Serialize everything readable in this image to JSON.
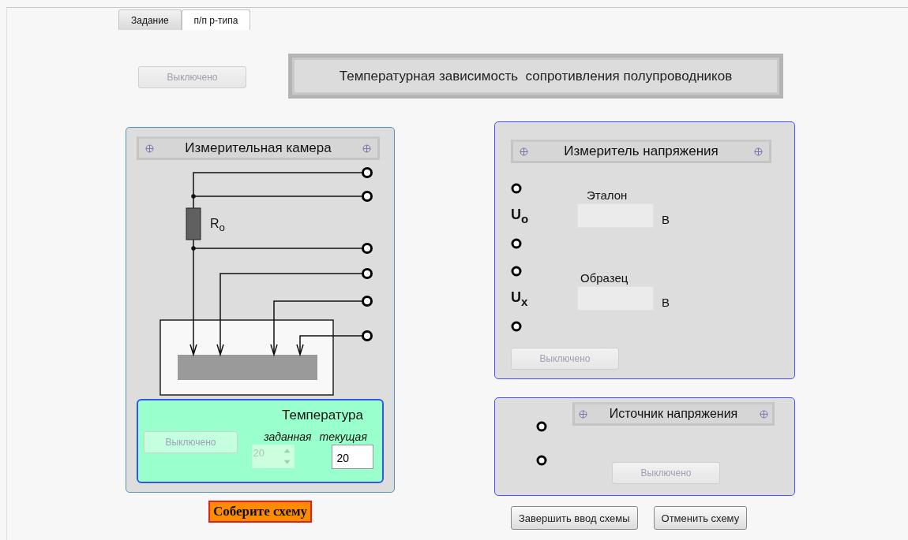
{
  "tabs": [
    {
      "label": "Задание",
      "selected": false
    },
    {
      "label": "п/п р-типа",
      "selected": true
    }
  ],
  "power_button": {
    "label": "Выключено",
    "disabled": true
  },
  "title": "Температурная зависимость  сопротивления полупроводников",
  "chamber": {
    "title": "Измерительная камера",
    "resistor_label": "R$_{o}$",
    "temperature": {
      "title": "Температура",
      "button": {
        "label": "Выключено",
        "disabled": true
      },
      "set_label": "заданная",
      "current_label": "текущая",
      "set_value": "20",
      "set_disabled": true,
      "current_value": "20"
    }
  },
  "voltmeter": {
    "title": "Измеритель напряжения",
    "reference": {
      "symbol": "U$_{o}$",
      "label": "Эталон",
      "unit": "В"
    },
    "sample": {
      "symbol": "U$_{x}$",
      "label": "Образец",
      "unit": "В"
    },
    "button": {
      "label": "Выключено",
      "disabled": true
    }
  },
  "source": {
    "title": "Источник напряжения",
    "button": {
      "label": "Выключено",
      "disabled": true
    }
  },
  "status": "Соберите схему",
  "actions": [
    "Завершить ввод схемы",
    "Отменить схему"
  ]
}
